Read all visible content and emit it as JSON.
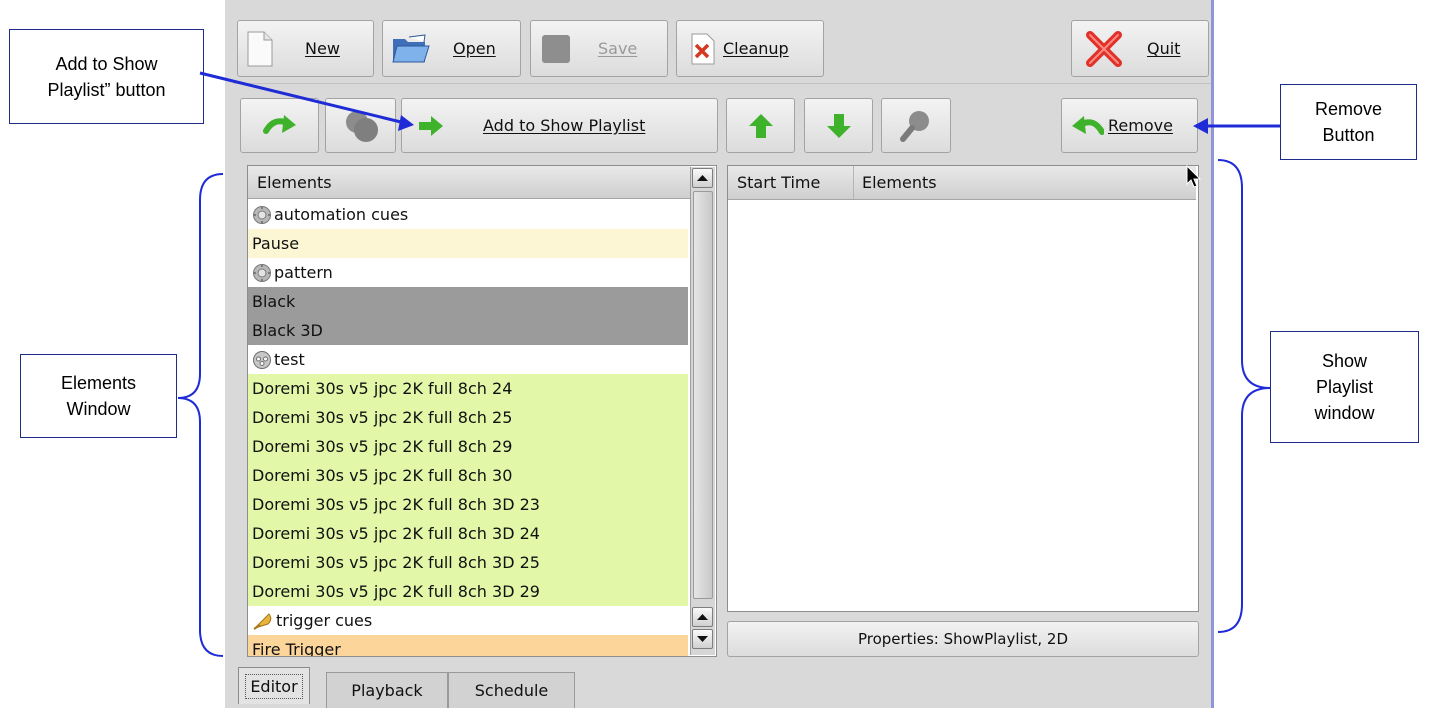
{
  "toolbar": {
    "new_label": "New",
    "open_label": "Open",
    "save_label": "Save",
    "cleanup_label": "Cleanup",
    "quit_label": "Quit"
  },
  "actionbar": {
    "add_label": "Add to Show Playlist",
    "remove_label": "Remove"
  },
  "elements_panel": {
    "header": "Elements",
    "items": [
      {
        "label": "automation cues",
        "icon": "gear-icon",
        "color": "#ffffff"
      },
      {
        "label": "Pause",
        "color": "#fdf6d5"
      },
      {
        "label": "pattern",
        "icon": "gear-icon",
        "color": "#ffffff"
      },
      {
        "label": "Black",
        "color": "#9b9b9b"
      },
      {
        "label": "Black 3D",
        "color": "#9b9b9b"
      },
      {
        "label": "test",
        "icon": "film-reel-icon",
        "color": "#ffffff"
      },
      {
        "label": "Doremi 30s v5 jpc 2K full 8ch 24",
        "color": "#e2f8a8"
      },
      {
        "label": "Doremi 30s v5 jpc 2K full 8ch 25",
        "color": "#e2f8a8"
      },
      {
        "label": "Doremi 30s v5 jpc 2K full 8ch 29",
        "color": "#e2f8a8"
      },
      {
        "label": "Doremi 30s v5 jpc 2K full 8ch 30",
        "color": "#e2f8a8"
      },
      {
        "label": "Doremi 30s v5 jpc 2K full 8ch 3D 23",
        "color": "#e2f8a8"
      },
      {
        "label": "Doremi 30s v5 jpc 2K full 8ch 3D 24",
        "color": "#e2f8a8"
      },
      {
        "label": "Doremi 30s v5 jpc 2K full 8ch 3D 25",
        "color": "#e2f8a8"
      },
      {
        "label": "Doremi 30s v5 jpc 2K full 8ch 3D 29",
        "color": "#e2f8a8"
      },
      {
        "label": "trigger cues",
        "icon": "bell-icon",
        "color": "#ffffff"
      },
      {
        "label": "Fire Trigger",
        "color": "#fcd59b"
      }
    ]
  },
  "playlist_panel": {
    "col_start_time": "Start Time",
    "col_elements": "Elements",
    "properties_label": "Properties: ShowPlaylist, 2D"
  },
  "tabs": [
    {
      "label": "Editor",
      "active": true
    },
    {
      "label": "Playback",
      "active": false
    },
    {
      "label": "Schedule",
      "active": false
    }
  ],
  "annotations": {
    "add_button_note": "Add to Show Playlist” button",
    "add_button_note_line1": "Add to Show",
    "add_button_note_line2": "Playlist” button",
    "remove_note_line1": "Remove",
    "remove_note_line2": "Button",
    "elements_note_line1": "Elements",
    "elements_note_line2": "Window",
    "playlist_note_line1": "Show",
    "playlist_note_line2": "Playlist",
    "playlist_note_line3": "window"
  },
  "colors": {
    "annotation_blue": "#1f2bd6",
    "green_arrow": "#3fb22b"
  }
}
